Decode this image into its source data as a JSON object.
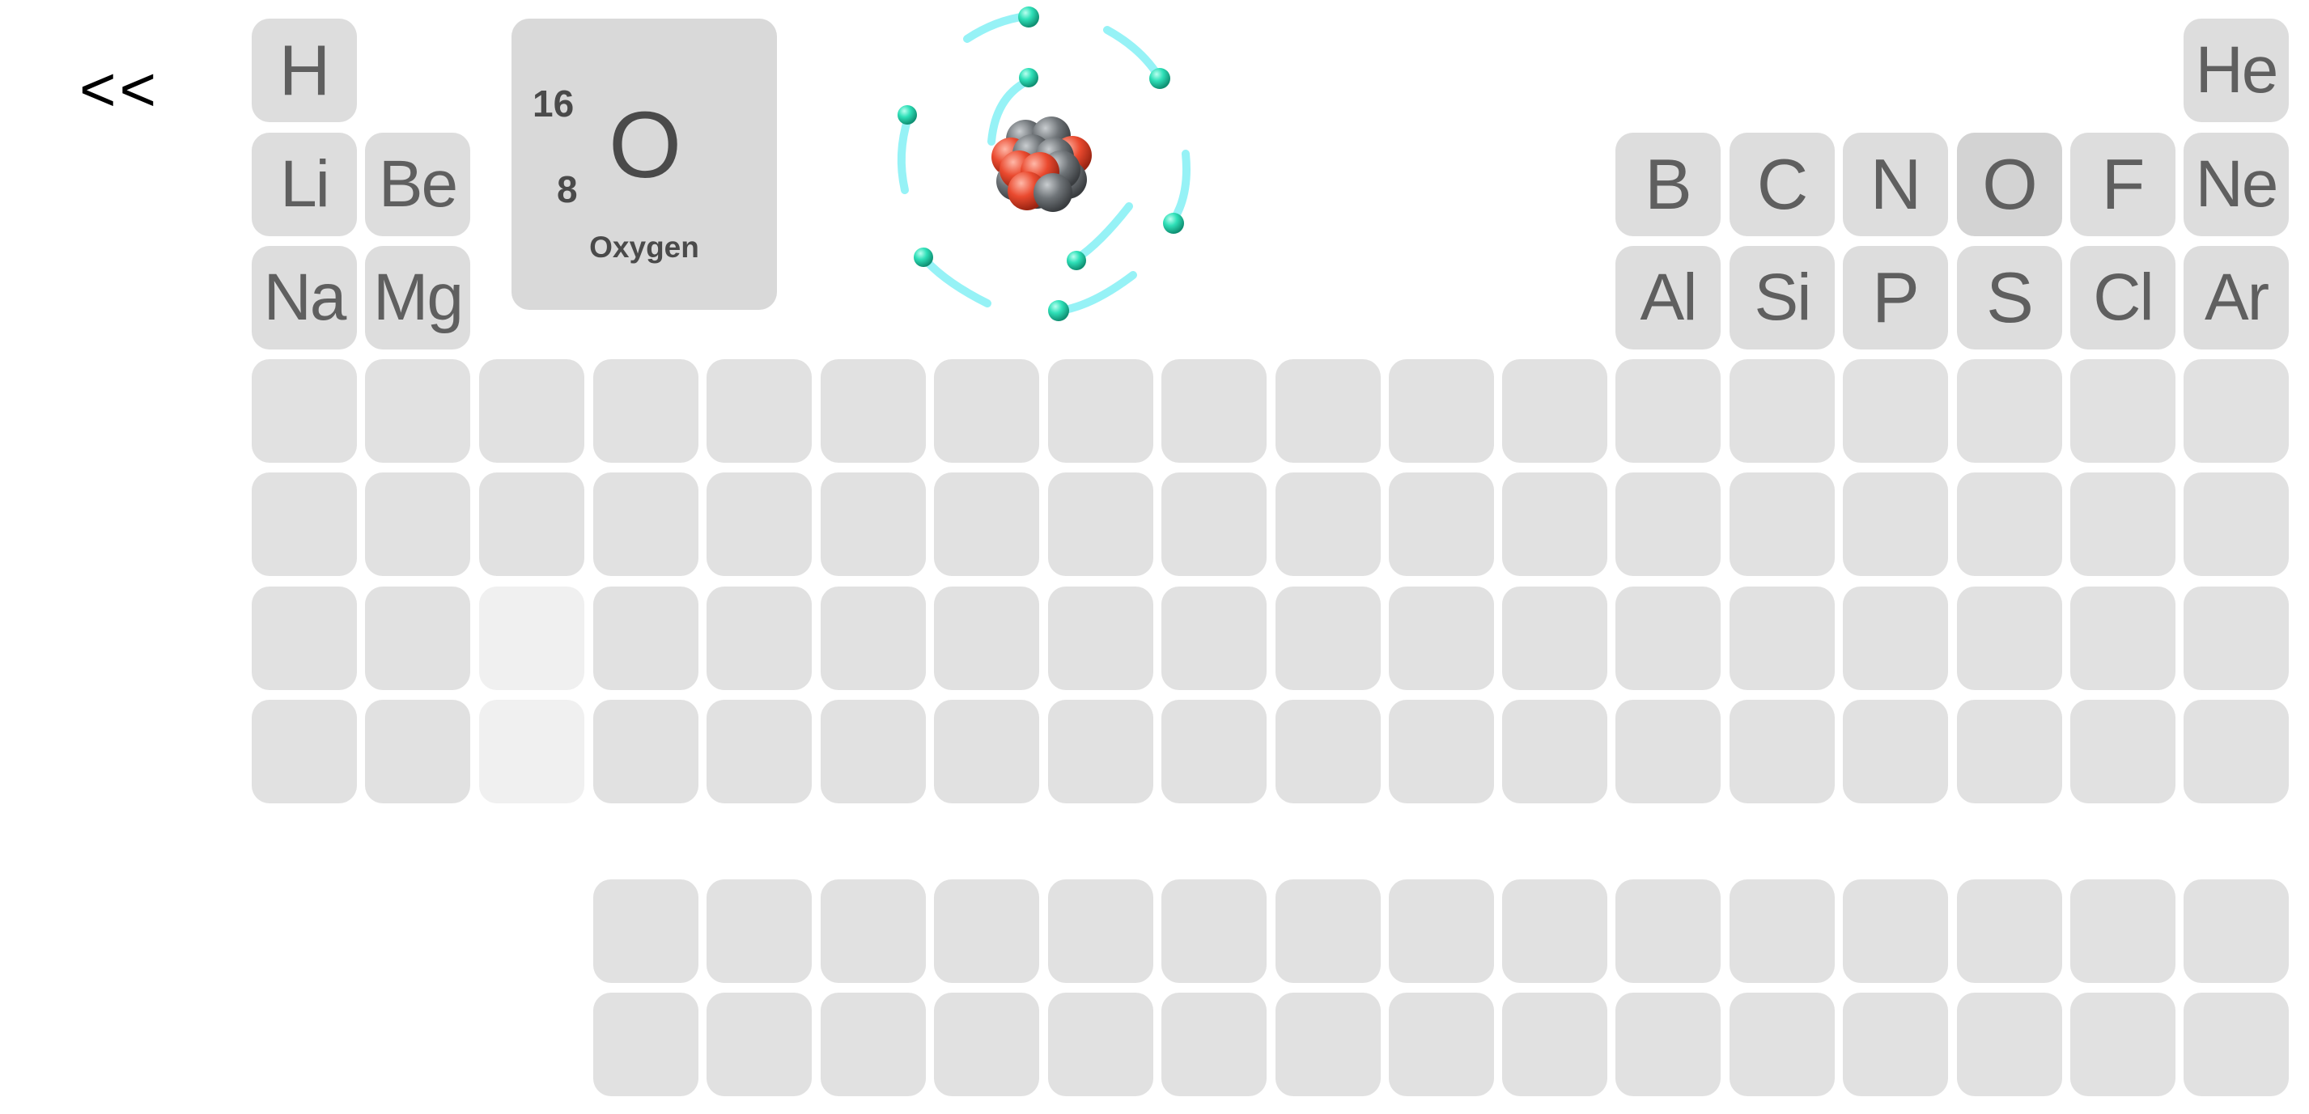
{
  "nav": {
    "back_label": "<<"
  },
  "selected_element": {
    "symbol": "O",
    "name": "Oxygen",
    "mass_number": "16",
    "atomic_number": "8",
    "electron_count": 8
  },
  "elements": {
    "H": "H",
    "He": "He",
    "Li": "Li",
    "Be": "Be",
    "B": "B",
    "C": "C",
    "N": "N",
    "O": "O",
    "F": "F",
    "Ne": "Ne",
    "Na": "Na",
    "Mg": "Mg",
    "Al": "Al",
    "Si": "Si",
    "P": "P",
    "S": "S",
    "Cl": "Cl",
    "Ar": "Ar"
  },
  "colors": {
    "cell": "#e1e1e1",
    "cell_selected": "#d3d3d3",
    "cell_dimmed": "#f0f0f0",
    "electron": "#1fd6ae",
    "trail": "#3fe7ee",
    "proton": "#e8452b",
    "neutron": "#6d7276"
  }
}
